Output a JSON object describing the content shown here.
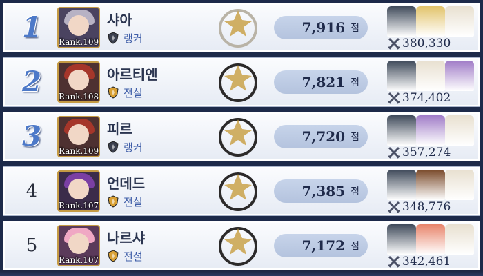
{
  "score_unit": "점",
  "rows": [
    {
      "rank": "1",
      "rank_style": "medal",
      "name": "샤아",
      "level": "Rank.109",
      "tier": "랭커",
      "tier_color": "#3a3f4e",
      "score": "7,916",
      "power": "380,330",
      "emblem": "silver-winged-emblem-icon",
      "avatar_hair": "#b7b2c4",
      "avatar_bg": "#4a4360",
      "heroes": [
        "#3f4a5a",
        "#e2c36a",
        "#e8e0d0"
      ]
    },
    {
      "rank": "2",
      "rank_style": "medal",
      "name": "아르티엔",
      "level": "Rank.108",
      "tier": "전설",
      "tier_color": "#d9a033",
      "score": "7,821",
      "power": "374,402",
      "emblem": "dark-moon-emblem-icon",
      "avatar_hair": "#a5362a",
      "avatar_bg": "#4e3131",
      "heroes": [
        "#3f4a5a",
        "#e8e0d0",
        "#a07cc7"
      ]
    },
    {
      "rank": "3",
      "rank_style": "medal",
      "name": "피르",
      "level": "Rank.109",
      "tier": "랭커",
      "tier_color": "#3a3f4e",
      "score": "7,720",
      "power": "357,274",
      "emblem": "dark-moon-emblem-icon",
      "avatar_hair": "#a5362a",
      "avatar_bg": "#4e3131",
      "heroes": [
        "#3f4a5a",
        "#a07cc7",
        "#e8e0d0"
      ]
    },
    {
      "rank": "4",
      "rank_style": "plain",
      "name": "언데드",
      "level": "Rank.107",
      "tier": "전설",
      "tier_color": "#d9a033",
      "score": "7,385",
      "power": "348,776",
      "emblem": "dark-moon-emblem-icon",
      "avatar_hair": "#7a3fa3",
      "avatar_bg": "#3b2c4a",
      "heroes": [
        "#3f4a5a",
        "#7a4a2a",
        "#e8e0d0"
      ]
    },
    {
      "rank": "5",
      "rank_style": "plain",
      "name": "나르샤",
      "level": "Rank.107",
      "tier": "전설",
      "tier_color": "#d9a033",
      "score": "7,172",
      "power": "342,461",
      "emblem": "dark-moon-emblem-icon",
      "avatar_hair": "#f0a8c4",
      "avatar_bg": "#5b3a5a",
      "heroes": [
        "#3f4a5a",
        "#e8846a",
        "#e8e0d0"
      ]
    }
  ]
}
